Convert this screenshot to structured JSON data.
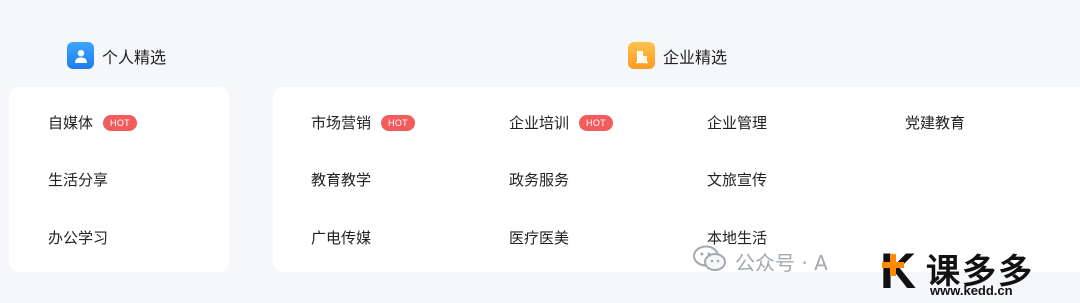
{
  "personal": {
    "title": "个人精选",
    "items": [
      {
        "label": "自媒体",
        "badge": "HOT"
      },
      {
        "label": "生活分享"
      },
      {
        "label": "办公学习"
      }
    ]
  },
  "enterprise": {
    "title": "企业精选",
    "items": [
      {
        "label": "市场营销",
        "badge": "HOT"
      },
      {
        "label": "企业培训",
        "badge": "HOT"
      },
      {
        "label": "企业管理"
      },
      {
        "label": "党建教育"
      },
      {
        "label": "教育教学"
      },
      {
        "label": "政务服务"
      },
      {
        "label": "文旅宣传"
      },
      {
        "label": "广电传媒"
      },
      {
        "label": "医疗医美"
      },
      {
        "label": "本地生活"
      }
    ]
  },
  "watermark": {
    "text": "公众号 · A",
    "brand_name": "课多多",
    "brand_url": "www.kedd.cn"
  },
  "colors": {
    "background": "#f5f7fa",
    "card": "#ffffff",
    "hot_badge": "#f25c5c",
    "personal_icon": "#2a8ff7",
    "enterprise_icon": "#ffab2e",
    "brand_accent": "#ff8a00"
  }
}
